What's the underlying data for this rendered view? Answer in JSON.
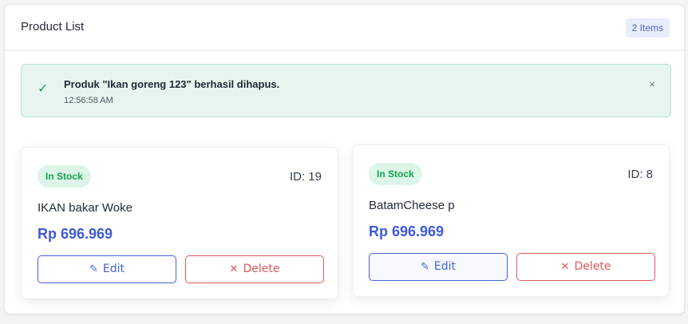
{
  "panel": {
    "title": "Product List",
    "count_badge": "2 Items"
  },
  "alert": {
    "message": "Produk \"Ikan goreng 123\" berhasil dihapus.",
    "time": "12:56:58 AM",
    "close_icon": "×",
    "check_icon": "✓"
  },
  "products": [
    {
      "stock": "In Stock",
      "id_label": "ID: 19",
      "name": "IKAN bakar Woke",
      "price": "Rp 696.969",
      "edit_label": "Edit",
      "delete_label": "Delete",
      "edit_icon": "✎",
      "delete_icon": "✕"
    },
    {
      "stock": "In Stock",
      "id_label": "ID: 8",
      "name": "BatamCheese p",
      "price": "Rp 696.969",
      "edit_label": "Edit",
      "delete_label": "Delete",
      "edit_icon": "✎",
      "delete_icon": "✕"
    }
  ],
  "colors": {
    "accent": "#4059d6",
    "success": "#16a34a",
    "danger": "#e05757"
  }
}
